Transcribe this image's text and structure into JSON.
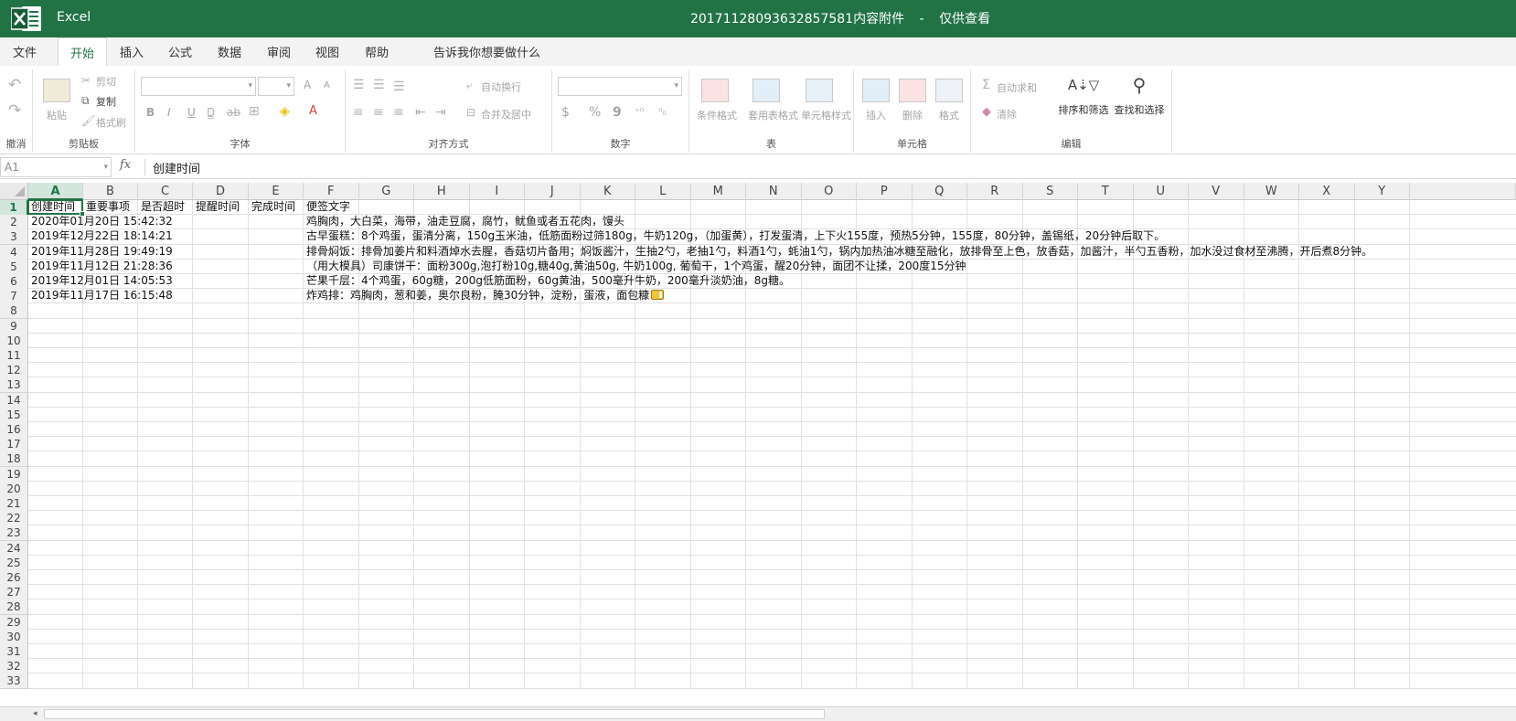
{
  "titlebar": {
    "app_name": "Excel",
    "document_title": "20171128093632857581内容附件",
    "separator": "-",
    "mode": "仅供查看"
  },
  "menu": {
    "tabs": [
      {
        "label": "文件"
      },
      {
        "label": "开始"
      },
      {
        "label": "插入"
      },
      {
        "label": "公式"
      },
      {
        "label": "数据"
      },
      {
        "label": "审阅"
      },
      {
        "label": "视图"
      },
      {
        "label": "帮助"
      }
    ],
    "active_index": 1,
    "tell_me": "告诉我你想要做什么"
  },
  "ribbon": {
    "undo": {
      "group_label": "撤消"
    },
    "clipboard": {
      "paste": "粘贴",
      "cut": "剪切",
      "copy": "复制",
      "format_painter": "格式刷",
      "group_label": "剪贴板"
    },
    "font": {
      "group_label": "字体",
      "bold": "B",
      "italic": "I",
      "underline": "U",
      "grow": "A",
      "shrink": "A"
    },
    "alignment": {
      "wrap_text": "自动换行",
      "merge_center": "合并及居中",
      "group_label": "对齐方式"
    },
    "number": {
      "currency": "$",
      "percent": "%",
      "comma": "9",
      "group_label": "数字"
    },
    "styles": {
      "conditional": "条件格式",
      "table_format": "套用表格式",
      "cell_styles": "单元格样式",
      "group_label": "表"
    },
    "cells": {
      "insert": "插入",
      "delete": "删除",
      "format": "格式",
      "group_label": "单元格"
    },
    "editing": {
      "autosum": "自动求和",
      "clear": "清除",
      "sort_filter": "排序和筛选",
      "find_select": "查找和选择",
      "group_label": "编辑"
    }
  },
  "formula_bar": {
    "name_box": "A1",
    "fx_label": "fx",
    "content": "创建时间"
  },
  "sheet": {
    "columns": [
      "A",
      "B",
      "C",
      "D",
      "E",
      "F",
      "G",
      "H",
      "I",
      "J",
      "K",
      "L",
      "M",
      "N",
      "O",
      "P",
      "Q",
      "R",
      "S",
      "T",
      "U",
      "V",
      "W",
      "X",
      "Y"
    ],
    "row_count": 33,
    "selected_col": "A",
    "selected_row": 1,
    "rows": [
      [
        "创建时间",
        "重要事项",
        "是否超时",
        "提醒时间",
        "完成时间",
        "便签文字"
      ],
      [
        "2020年01月20日 15:42:32",
        "",
        "",
        "",
        "",
        "鸡胸肉，大白菜，海带，油走豆腐，腐竹，鱿鱼或者五花肉，馒头"
      ],
      [
        "2019年12月22日 18:14:21",
        "",
        "",
        "",
        "",
        "古早蛋糕：8个鸡蛋，蛋清分离，150g玉米油，低筋面粉过筛180g，牛奶120g，（加蛋黄），打发蛋清，上下火155度，预热5分钟，155度，80分钟，盖锡纸，20分钟后取下。"
      ],
      [
        "2019年11月28日 19:49:19",
        "",
        "",
        "",
        "",
        "排骨焖饭：排骨加姜片和料酒焯水去腥，香菇切片备用；焖饭酱汁，生抽2勺，老抽1勺，料酒1勺，蚝油1勺，锅内加热油冰糖至融化，放排骨至上色，放香菇，加酱汁，半勺五香粉，加水没过食材至沸腾，开后煮8分钟。"
      ],
      [
        "2019年11月12日 21:28:36",
        "",
        "",
        "",
        "",
        "（用大模具）司康饼干：面粉300g,泡打粉10g,糖40g,黄油50g, 牛奶100g, 葡萄干，1个鸡蛋，醒20分钟，面团不让揉，200度15分钟"
      ],
      [
        "2019年12月01日 14:05:53",
        "",
        "",
        "",
        "",
        "芒果千层：4个鸡蛋，60g糖，200g低筋面粉，60g黄油，500毫升牛奶，200毫升淡奶油，8g糖。"
      ],
      [
        "2019年11月17日 16:15:48",
        "",
        "",
        "",
        "",
        "炸鸡排：鸡胸肉，葱和姜，奥尔良粉，腌30分钟，淀粉，蛋液，面包糠"
      ]
    ],
    "note_icon_row": 7
  },
  "colors": {
    "brand": "#217346",
    "selection_header": "#d3e6dc",
    "grid_line": "#e1e1e1"
  }
}
